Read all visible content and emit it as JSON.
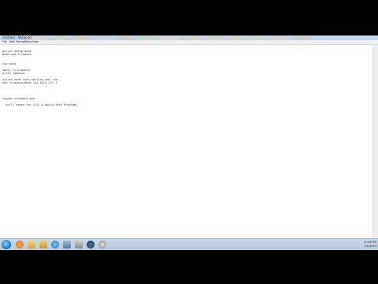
{
  "window": {
    "title": "Untitled - Notepad",
    "menu": [
      "File",
      "Edit",
      "Format",
      "View",
      "Help"
    ]
  },
  "editor": {
    "lines": [
      "",
      "active debug mode",
      "Download Firmware",
      "",
      "",
      "fix push",
      "",
      "apply stringdata",
      "write command",
      "",
      "unlock mode then editing cmd, etc",
      "add firmware/mode +A1.64/2 /vl 1",
      "",
      "",
      "",
      "",
      "repeat category mod",
      "",
      "- grill space for fill & mould then Program)"
    ]
  },
  "taskbar": {
    "clock_time": "11:48 PM",
    "clock_date": "1/1/2013"
  },
  "colors": {
    "taskbar": "#b6c9de",
    "background": "#000000",
    "editor": "#ffffff"
  }
}
